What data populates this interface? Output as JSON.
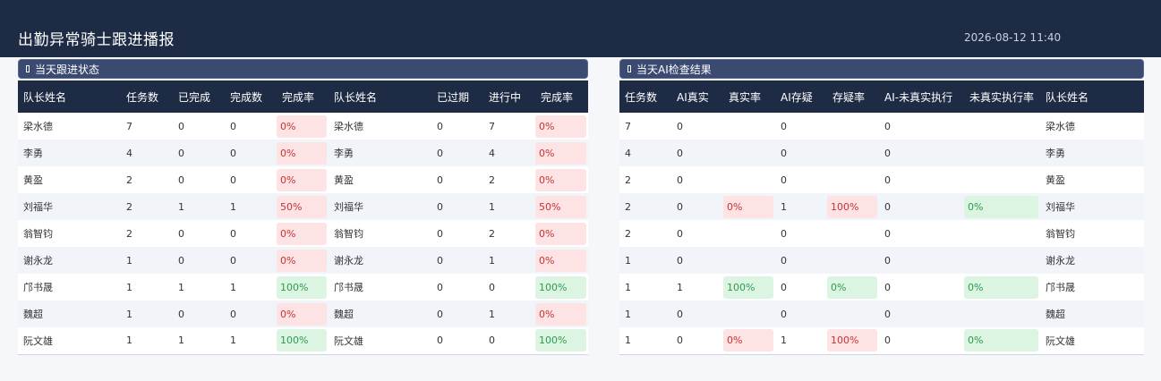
{
  "header": {
    "title": "出勤异常骑士跟进播报",
    "timestamp": "2026-08-12 11:40"
  },
  "left": {
    "title": "当天跟进状态",
    "columns": [
      "队长姓名",
      "任务数",
      "已完成",
      "完成数",
      "完成率",
      "队长姓名",
      "已过期",
      "进行中",
      "完成率"
    ],
    "rows": [
      [
        "梁水德",
        "7",
        "0",
        "0",
        "0%",
        "梁水德",
        "0",
        "7",
        "0%"
      ],
      [
        "李勇",
        "4",
        "0",
        "0",
        "0%",
        "李勇",
        "0",
        "4",
        "0%"
      ],
      [
        "黄盈",
        "2",
        "0",
        "0",
        "0%",
        "黄盈",
        "0",
        "2",
        "0%"
      ],
      [
        "刘福华",
        "2",
        "1",
        "1",
        "50%",
        "刘福华",
        "0",
        "1",
        "50%"
      ],
      [
        "翁智钧",
        "2",
        "0",
        "0",
        "0%",
        "翁智钧",
        "0",
        "2",
        "0%"
      ],
      [
        "谢永龙",
        "1",
        "0",
        "0",
        "0%",
        "谢永龙",
        "0",
        "1",
        "0%"
      ],
      [
        "邝书晟",
        "1",
        "1",
        "1",
        "100%",
        "邝书晟",
        "0",
        "0",
        "100%"
      ],
      [
        "魏超",
        "1",
        "0",
        "0",
        "0%",
        "魏超",
        "0",
        "1",
        "0%"
      ],
      [
        "阮文雄",
        "1",
        "1",
        "1",
        "100%",
        "阮文雄",
        "0",
        "0",
        "100%"
      ]
    ]
  },
  "right": {
    "title": "当天AI检查结果",
    "columns": [
      "任务数",
      "AI真实",
      "真实率",
      "AI存疑",
      "存疑率",
      "AI-未真实执行",
      "未真实执行率",
      "队长姓名"
    ],
    "rows": [
      [
        "7",
        "0",
        "",
        "0",
        "",
        "0",
        "",
        "梁水德"
      ],
      [
        "4",
        "0",
        "",
        "0",
        "",
        "0",
        "",
        "李勇"
      ],
      [
        "2",
        "0",
        "",
        "0",
        "",
        "0",
        "",
        "黄盈"
      ],
      [
        "2",
        "0",
        "0%",
        "1",
        "100%",
        "0",
        "0%",
        "刘福华"
      ],
      [
        "2",
        "0",
        "",
        "0",
        "",
        "0",
        "",
        "翁智钧"
      ],
      [
        "1",
        "0",
        "",
        "0",
        "",
        "0",
        "",
        "谢永龙"
      ],
      [
        "1",
        "1",
        "100%",
        "0",
        "0%",
        "0",
        "0%",
        "邝书晟"
      ],
      [
        "1",
        "0",
        "",
        "0",
        "",
        "0",
        "",
        "魏超"
      ],
      [
        "1",
        "0",
        "0%",
        "1",
        "100%",
        "0",
        "0%",
        "阮文雄"
      ]
    ]
  },
  "colors": {
    "header_bg": "#1e2b44",
    "section_bg": "#3a4a70",
    "good": "#2c9a4e",
    "good_bg": "#dcf5e2",
    "bad": "#c83232",
    "bad_bg": "#fde3e3"
  }
}
